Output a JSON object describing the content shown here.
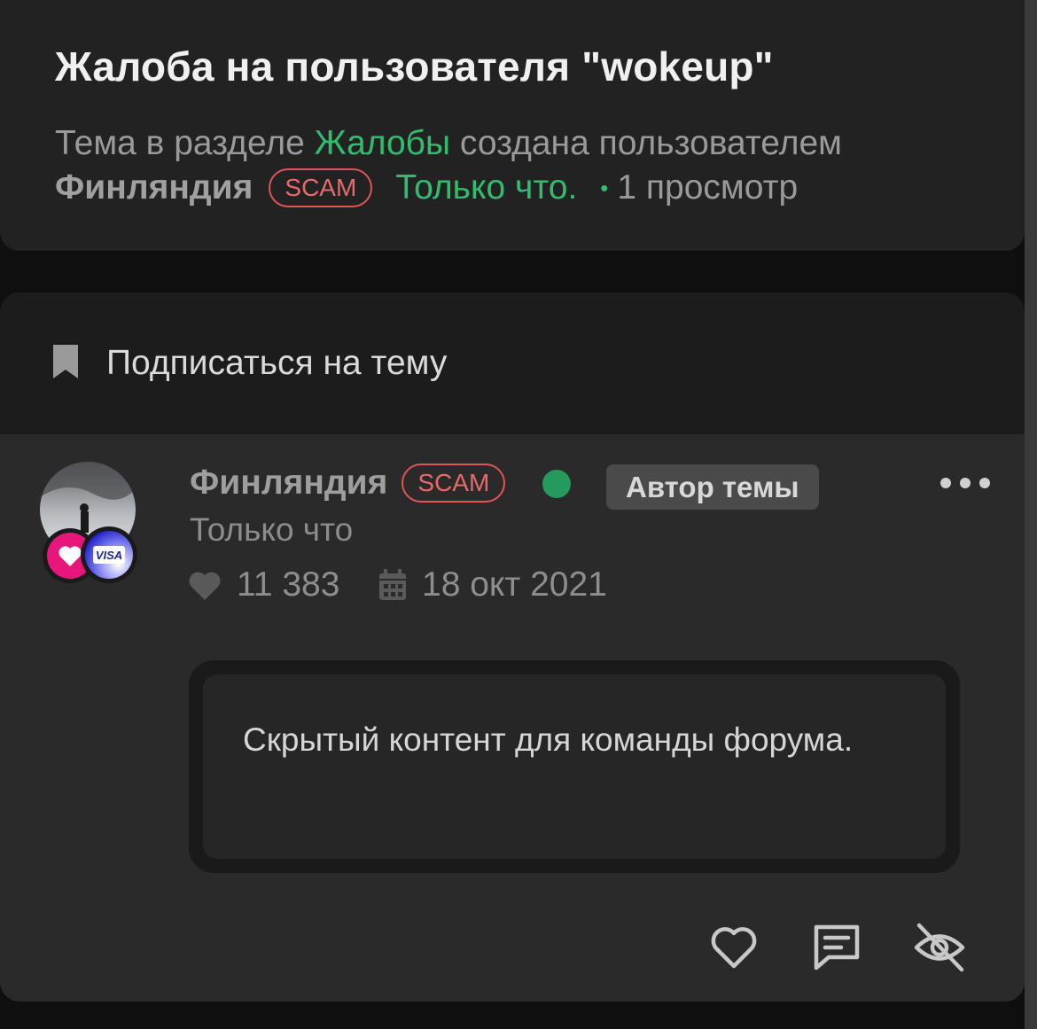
{
  "thread": {
    "title": "Жалоба на пользователя \"wokeup\"",
    "meta_prefix": "Тема в разделе",
    "section": "Жалобы",
    "meta_created": "создана пользователем",
    "author": "Финляндия",
    "author_badge": "SCAM",
    "time": "Только что.",
    "views": "1 просмотр"
  },
  "subscribe": {
    "label": "Подписаться на тему",
    "icon": "bookmark-icon"
  },
  "post": {
    "author": "Финляндия",
    "author_badge": "SCAM",
    "online": true,
    "author_tag": "Автор темы",
    "time": "Только что",
    "likes": "11 383",
    "date": "18 окт 2021",
    "badges": [
      "heart-badge-icon",
      "visa-badge-icon"
    ],
    "visa_text": "VISA",
    "content": "Скрытый контент для команды форума."
  },
  "actions": [
    "like-icon",
    "reply-icon",
    "hide-icon"
  ],
  "colors": {
    "accent_green": "#2fbd6e",
    "scam_red": "#e05555",
    "online_green": "#249a5c",
    "background": "#0f0f0f",
    "card": "#2a2a2a"
  }
}
